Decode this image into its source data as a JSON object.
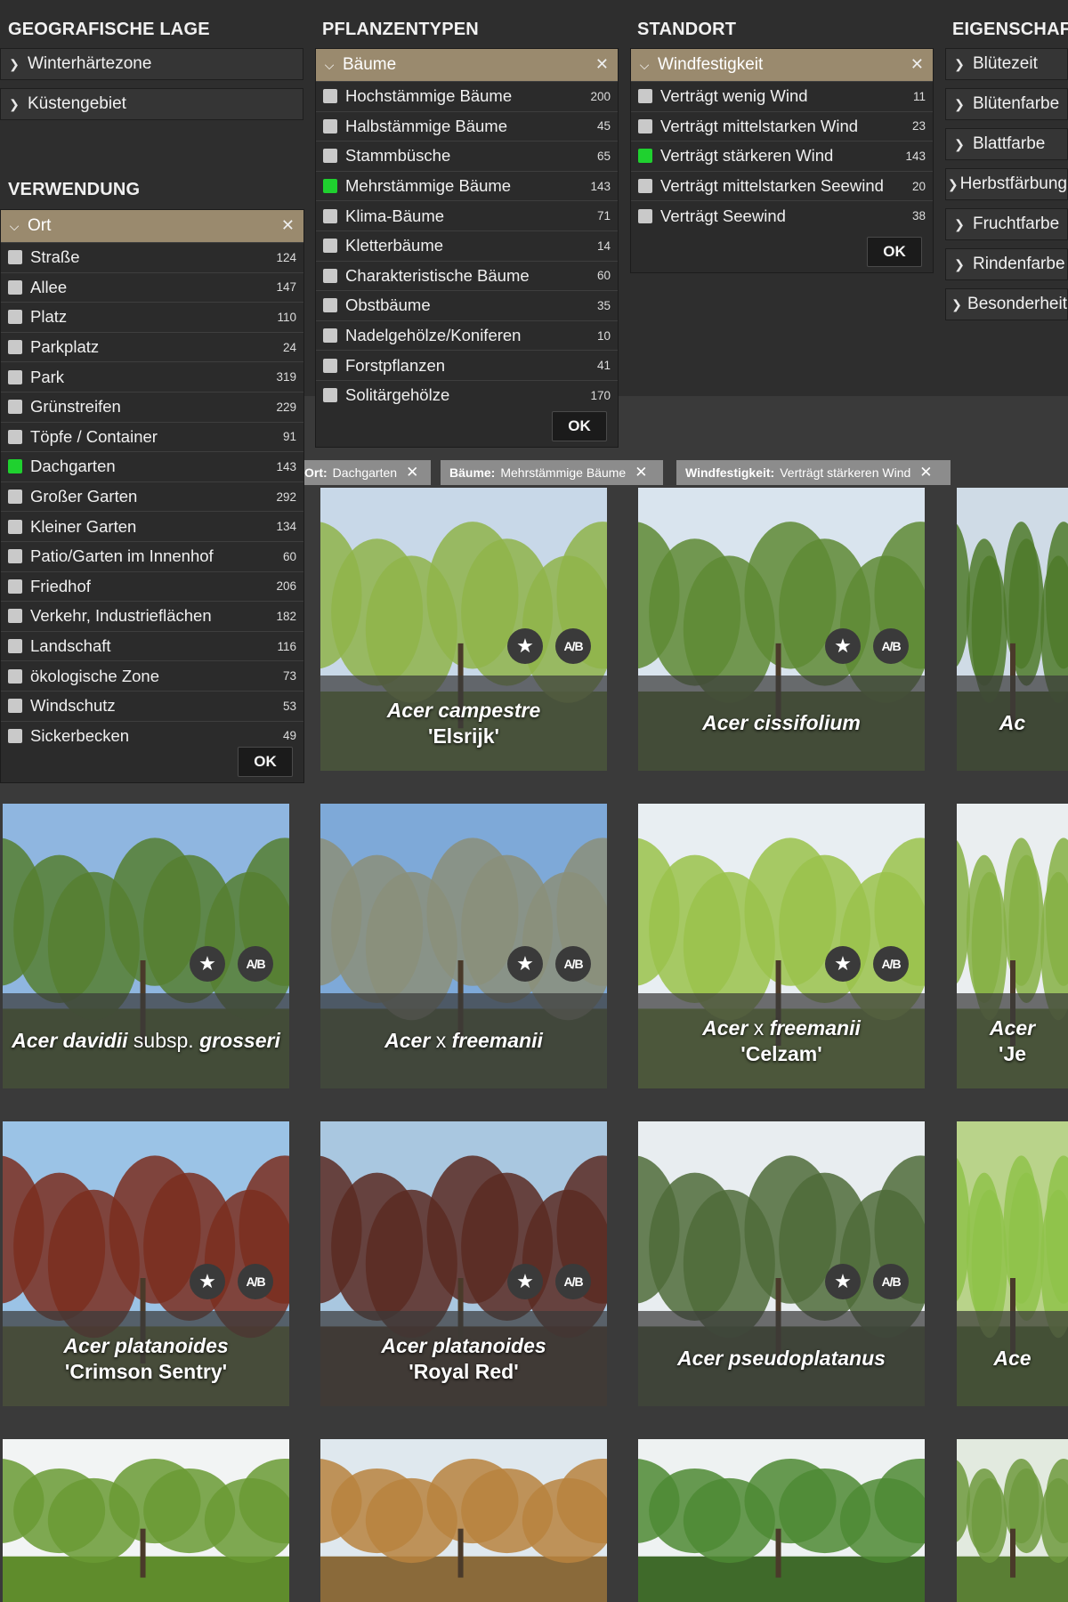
{
  "colors": {
    "header_accent": "#9a8a6e",
    "checked": "#1fd12f",
    "unchecked": "#c9c9c9",
    "chip": "#8c8c8c"
  },
  "geo": {
    "title": "GEOGRAFISCHE LAGE",
    "items": [
      "Winterhärtezone",
      "Küstengebiet"
    ]
  },
  "verwendung": {
    "title": "VERWENDUNG",
    "panel": {
      "header": "Ort",
      "ok": "OK",
      "options": [
        {
          "label": "Straße",
          "count": "124",
          "checked": false
        },
        {
          "label": "Allee",
          "count": "147",
          "checked": false
        },
        {
          "label": "Platz",
          "count": "110",
          "checked": false
        },
        {
          "label": "Parkplatz",
          "count": "24",
          "checked": false
        },
        {
          "label": "Park",
          "count": "319",
          "checked": false
        },
        {
          "label": "Grünstreifen",
          "count": "229",
          "checked": false
        },
        {
          "label": "Töpfe / Container",
          "count": "91",
          "checked": false
        },
        {
          "label": "Dachgarten",
          "count": "143",
          "checked": true
        },
        {
          "label": "Großer Garten",
          "count": "292",
          "checked": false
        },
        {
          "label": "Kleiner Garten",
          "count": "134",
          "checked": false
        },
        {
          "label": "Patio/Garten im Innenhof",
          "count": "60",
          "checked": false
        },
        {
          "label": "Friedhof",
          "count": "206",
          "checked": false
        },
        {
          "label": "Verkehr, Industrieflächen",
          "count": "182",
          "checked": false
        },
        {
          "label": "Landschaft",
          "count": "116",
          "checked": false
        },
        {
          "label": "ökologische Zone",
          "count": "73",
          "checked": false
        },
        {
          "label": "Windschutz",
          "count": "53",
          "checked": false
        },
        {
          "label": "Sickerbecken",
          "count": "49",
          "checked": false
        }
      ]
    }
  },
  "pflanzentypen": {
    "title": "PFLANZENTYPEN",
    "panel": {
      "header": "Bäume",
      "ok": "OK",
      "options": [
        {
          "label": "Hochstämmige Bäume",
          "count": "200",
          "checked": false
        },
        {
          "label": "Halbstämmige Bäume",
          "count": "45",
          "checked": false
        },
        {
          "label": "Stammbüsche",
          "count": "65",
          "checked": false
        },
        {
          "label": "Mehrstämmige Bäume",
          "count": "143",
          "checked": true
        },
        {
          "label": "Klima-Bäume",
          "count": "71",
          "checked": false
        },
        {
          "label": "Kletterbäume",
          "count": "14",
          "checked": false
        },
        {
          "label": "Charakteristische Bäume",
          "count": "60",
          "checked": false
        },
        {
          "label": "Obstbäume",
          "count": "35",
          "checked": false
        },
        {
          "label": "Nadelgehölze/Koniferen",
          "count": "10",
          "checked": false
        },
        {
          "label": "Forstpflanzen",
          "count": "41",
          "checked": false
        },
        {
          "label": "Solitärgehölze",
          "count": "170",
          "checked": false
        }
      ]
    }
  },
  "standort": {
    "title": "STANDORT",
    "panel": {
      "header": "Windfestigkeit",
      "ok": "OK",
      "options": [
        {
          "label": "Verträgt wenig Wind",
          "count": "11",
          "checked": false
        },
        {
          "label": "Verträgt mittelstarken Wind",
          "count": "23",
          "checked": false
        },
        {
          "label": "Verträgt stärkeren Wind",
          "count": "143",
          "checked": true
        },
        {
          "label": "Verträgt mittelstarken Seewind",
          "count": "20",
          "checked": false
        },
        {
          "label": "Verträgt Seewind",
          "count": "38",
          "checked": false
        }
      ]
    }
  },
  "eigenschaft": {
    "title": "EIGENSCHAFT",
    "items": [
      "Blütezeit",
      "Blütenfarbe",
      "Blattfarbe",
      "Herbstfärbung",
      "Fruchtfarbe",
      "Rindenfarbe",
      "Besonderheit"
    ]
  },
  "chips": [
    {
      "key": "Ort:",
      "value": "Dachgarten"
    },
    {
      "key": "Bäume:",
      "value": "Mehrstämmige Bäume"
    },
    {
      "key": "Windfestigkeit:",
      "value": "Verträgt stärkeren Wind"
    }
  ],
  "card_icons": {
    "favorite": "★",
    "compare": "A/B"
  },
  "cards": [
    {
      "species": "",
      "cultivar": "",
      "bg": "#6e8f3e",
      "sky": "#b7cbe0",
      "foliage": "#7da348"
    },
    {
      "species": "Acer campestre",
      "cultivar": "'Elsrijk'",
      "bg": "#6e8f3e",
      "sky": "#c8d8e8",
      "foliage": "#8fb44a"
    },
    {
      "species": "Acer cissifolium",
      "cultivar": "",
      "bg": "#5c7a35",
      "sky": "#d9e4ee",
      "foliage": "#5e8a34"
    },
    {
      "species": "Ac",
      "cultivar": "",
      "bg": "#4e6e2c",
      "sky": "#cfdbe6",
      "foliage": "#4f7a2a"
    },
    {
      "species": "Acer davidii",
      "sub": "subsp.",
      "species2": "grosseri",
      "cultivar": "",
      "bg": "#5b7a33",
      "sky": "#8fb6e0",
      "foliage": "#567f30"
    },
    {
      "species": "Acer",
      "cross": "x",
      "species2": "freemanii",
      "cultivar": "",
      "bg": "#55683e",
      "sky": "#7ea9d8",
      "foliage": "#8b8f7a"
    },
    {
      "species": "Acer",
      "cross": "x",
      "species2": "freemanii",
      "cultivar": "'Celzam'",
      "bg": "#7aa23e",
      "sky": "#e8eef2",
      "foliage": "#9ac24b"
    },
    {
      "species": "Acer",
      "cultivar": "'Je",
      "bg": "#6f963a",
      "sky": "#eaeef0",
      "foliage": "#86b044"
    },
    {
      "species": "Acer platanoides",
      "cultivar": "'Crimson Sentry'",
      "bg": "#6a7a3a",
      "sky": "#9bc3e6",
      "foliage": "#7a2e1e"
    },
    {
      "species": "Acer platanoides",
      "cultivar": "'Royal Red'",
      "bg": "#4f3a2c",
      "sky": "#a9c7e0",
      "foliage": "#5a2a22"
    },
    {
      "species": "Acer pseudoplatanus",
      "cultivar": "",
      "bg": "#4d5e38",
      "sky": "#e8edf0",
      "foliage": "#4f6b3a"
    },
    {
      "species": "Ace",
      "cultivar": "",
      "bg": "#5d8a2e",
      "sky": "#b9d38a",
      "foliage": "#8fc24a"
    },
    {
      "species": "",
      "cultivar": "",
      "bg": "#5f8c2c",
      "sky": "#f2f4f4",
      "foliage": "#6a9a34"
    },
    {
      "species": "",
      "cultivar": "",
      "bg": "#8a6a3a",
      "sky": "#dfe8ee",
      "foliage": "#b8823e"
    },
    {
      "species": "",
      "cultivar": "",
      "bg": "#3f6a2a",
      "sky": "#eef2f2",
      "foliage": "#4d8a34"
    },
    {
      "species": "",
      "cultivar": "",
      "bg": "#5a7f34",
      "sky": "#e2eadf",
      "foliage": "#6f9a3e"
    }
  ]
}
